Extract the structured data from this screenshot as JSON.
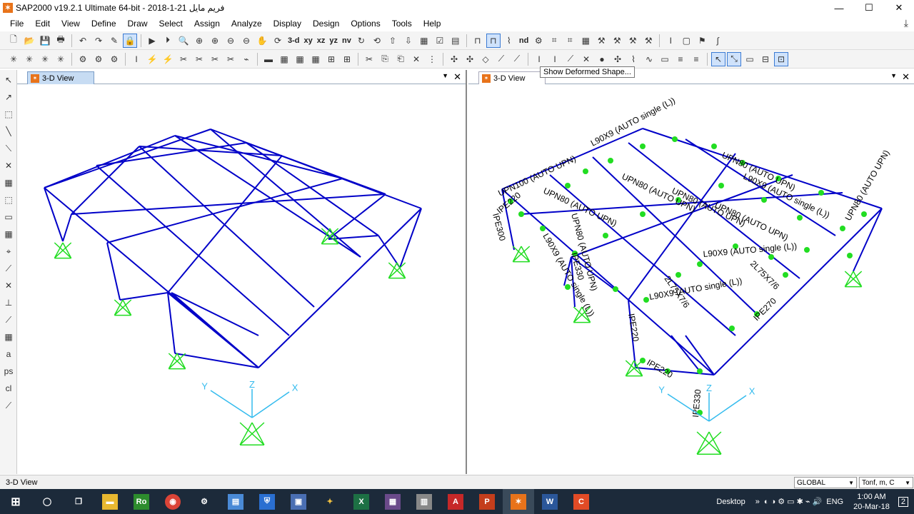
{
  "window": {
    "title": "SAP2000 v19.2.1 Ultimate 64-bit - 2018-1-21 فريم مايل",
    "minimize": "—",
    "maximize": "☐",
    "close": "✕"
  },
  "menu": [
    "File",
    "Edit",
    "View",
    "Define",
    "Draw",
    "Select",
    "Assign",
    "Analyze",
    "Display",
    "Design",
    "Options",
    "Tools",
    "Help"
  ],
  "toolbar": {
    "view_3d": "3-d",
    "view_xy": "xy",
    "view_xz": "xz",
    "view_yz": "yz",
    "view_nv": "nv",
    "nd": "nd",
    "tooltip": "Show Deformed Shape..."
  },
  "panes": {
    "left_tab": "3-D View",
    "right_tab": "3-D View"
  },
  "axes": {
    "x": "X",
    "y": "Y",
    "z": "Z"
  },
  "frame_labels": [
    "L90X9 (AUTO single (L))",
    "UPN80 (AUTO UPN)",
    "UPN100 (AUTO UPN)",
    "UPN80 (AUTO UPN)",
    "UPN80 (AUTO UPN)",
    "UPN80 (AUTO UPN)",
    "UPN80 (AUTO UPN)",
    "L90X9 (AUTO single (L))",
    "L90X9 (AUTO single (L))",
    "L90X9 (AUTO single (L))",
    "2L75X7/6",
    "2L75X7/6",
    "IPE220",
    "IPE220",
    "IPE270",
    "IPE330",
    "IPE300",
    "IPE330",
    "IPE220",
    "UPN80 (AUTO UPN)",
    "UPN80 (AUTO UPN)",
    "L90X9 (AUTO single (L))"
  ],
  "status": {
    "left": "3-D View",
    "coord": "GLOBAL",
    "units": "Tonf, m, C"
  },
  "taskbar": {
    "desktop": "Desktop",
    "lang": "ENG",
    "time": "1:00 AM",
    "date": "20-Mar-18",
    "notif": "2"
  },
  "colors": {
    "frame": "#0000c8",
    "support": "#22dd22",
    "axis": "#33bbee",
    "label": "#000000",
    "taskbar": "#1c2a3a"
  }
}
